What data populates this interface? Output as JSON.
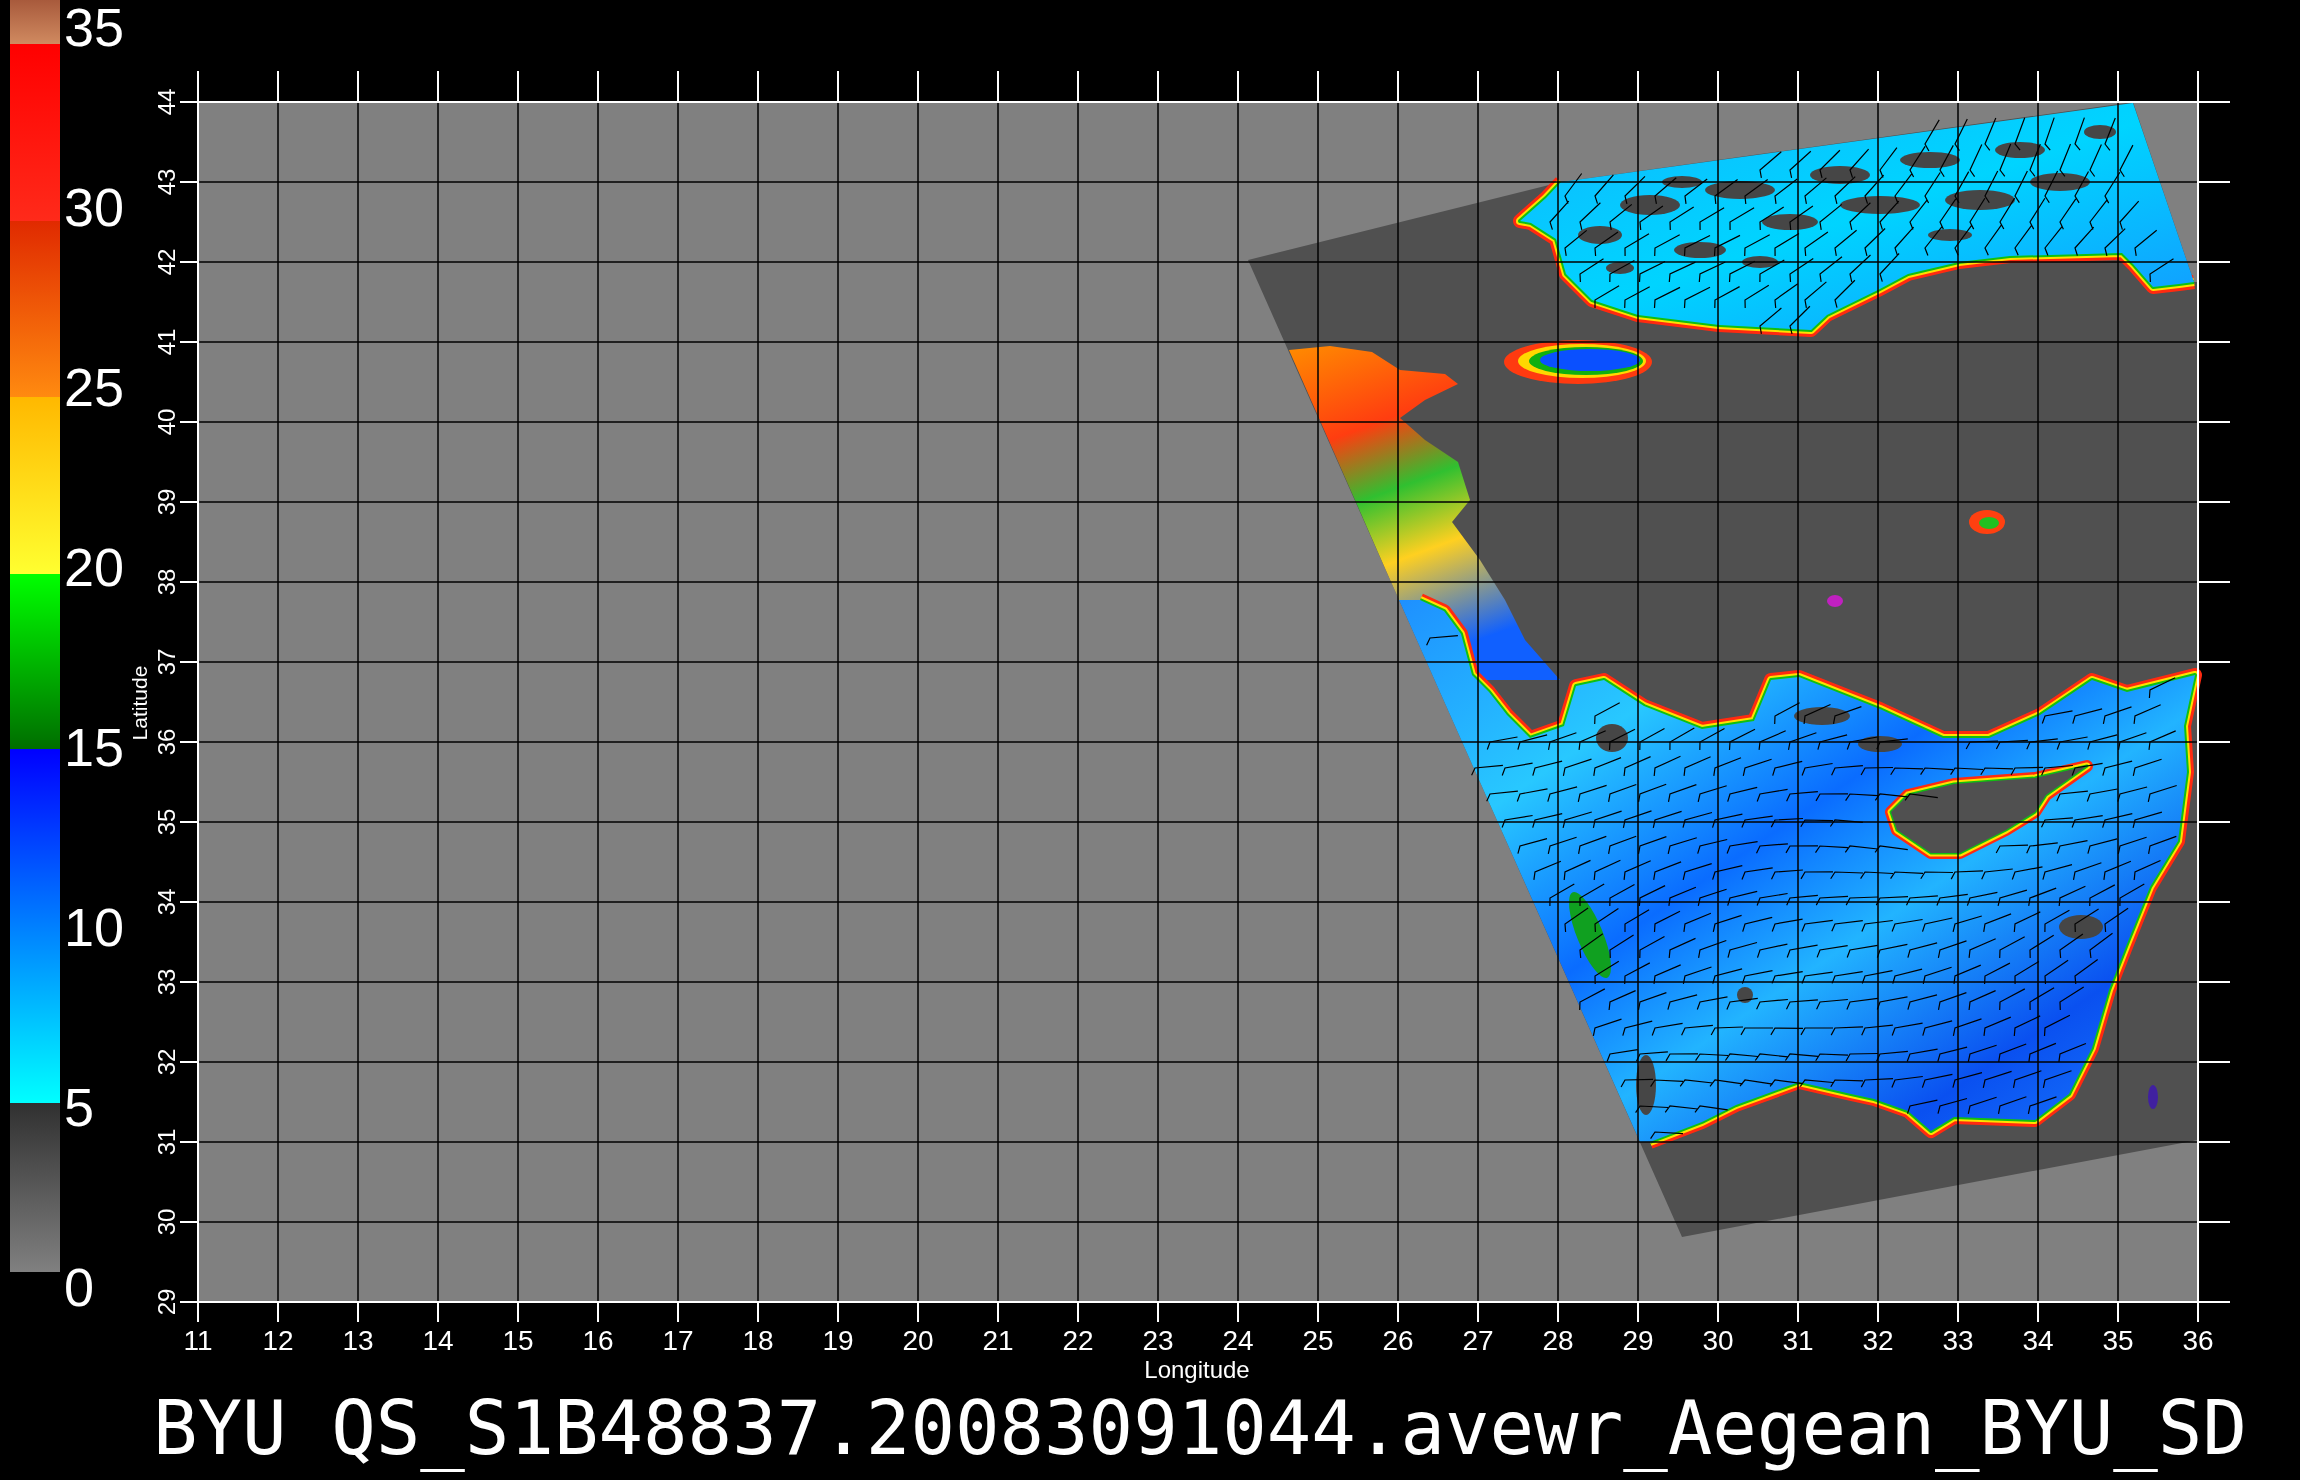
{
  "color_scale": {
    "labels": [
      "35",
      "30",
      "25",
      "20",
      "15",
      "10",
      "5",
      "0"
    ]
  },
  "map": {
    "y_axis": {
      "title": "Latitude",
      "tick_labels": [
        "29",
        "30",
        "31",
        "32",
        "33",
        "34",
        "35",
        "36",
        "37",
        "38",
        "39",
        "40",
        "41",
        "42",
        "43",
        "44"
      ]
    },
    "x_axis": {
      "title": "Longitude",
      "tick_labels": [
        "11",
        "12",
        "13",
        "14",
        "15",
        "16",
        "17",
        "18",
        "19",
        "20",
        "21",
        "22",
        "23",
        "24",
        "25",
        "26",
        "27",
        "28",
        "29",
        "30",
        "31",
        "32",
        "33",
        "34",
        "35",
        "36"
      ]
    }
  },
  "title": "BYU QS_S1B48837.20083091044.avewr_Aegean_BYU_SD"
}
